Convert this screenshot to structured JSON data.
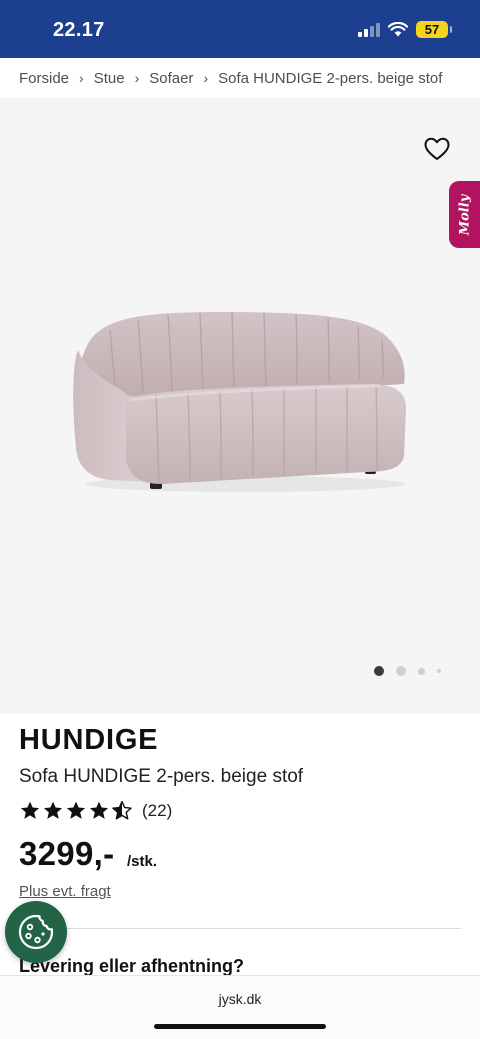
{
  "status_bar": {
    "time": "22.17",
    "battery": "57"
  },
  "breadcrumb": [
    "Forside",
    "Stue",
    "Sofaer",
    "Sofa HUNDIGE 2-pers. beige stof"
  ],
  "gallery": {
    "assistant_tab": "Molly",
    "wishlist_icon": "heart-outline-icon",
    "image_count": 4,
    "active_image": 1
  },
  "product": {
    "brand": "HUNDIGE",
    "name": "Sofa HUNDIGE 2-pers. beige stof",
    "rating": 4.5,
    "review_count": "(22)",
    "price": "3299,-",
    "unit": "/stk.",
    "freight_link": "Plus evt. fragt",
    "delivery_heading": "Levering eller afhentning?"
  },
  "browser": {
    "url": "jysk.dk"
  },
  "colors": {
    "header": "#1d3f8f",
    "cookie": "#236447",
    "molly": "#b2135e"
  }
}
